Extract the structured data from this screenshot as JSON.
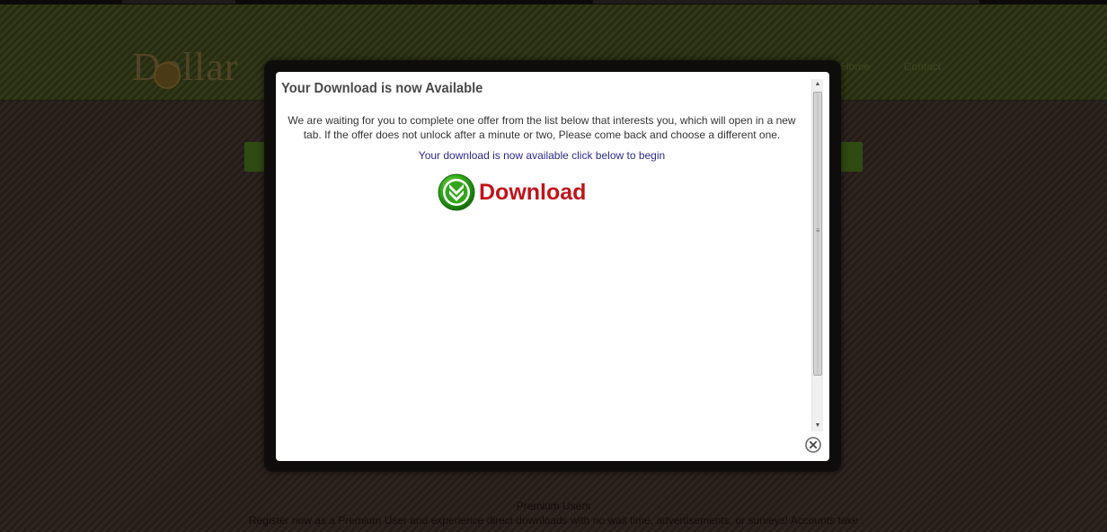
{
  "background": {
    "logo_text": "Dollar",
    "nav": [
      "Home",
      "Contact"
    ],
    "footer_title": "Premium Users",
    "footer_text": "Register now as a Premium User and experience direct downloads with no wait time, advertisements, or surveys! Accounts take"
  },
  "modal": {
    "title": "Your Download is now Available",
    "instructions": "We are waiting for you to complete one offer from the list below that interests you, which will open in a new tab. If the offer does not unlock after a minute or two, Please come back and choose a different one.",
    "available_text": "Your download is now available click below to begin",
    "download_label": "Download",
    "download_icon": "download-arrow-icon",
    "close_icon": "close-icon"
  },
  "colors": {
    "download_text": "#c0141a",
    "download_icon": "#2fa51a",
    "link_text": "#2c2a8a"
  }
}
